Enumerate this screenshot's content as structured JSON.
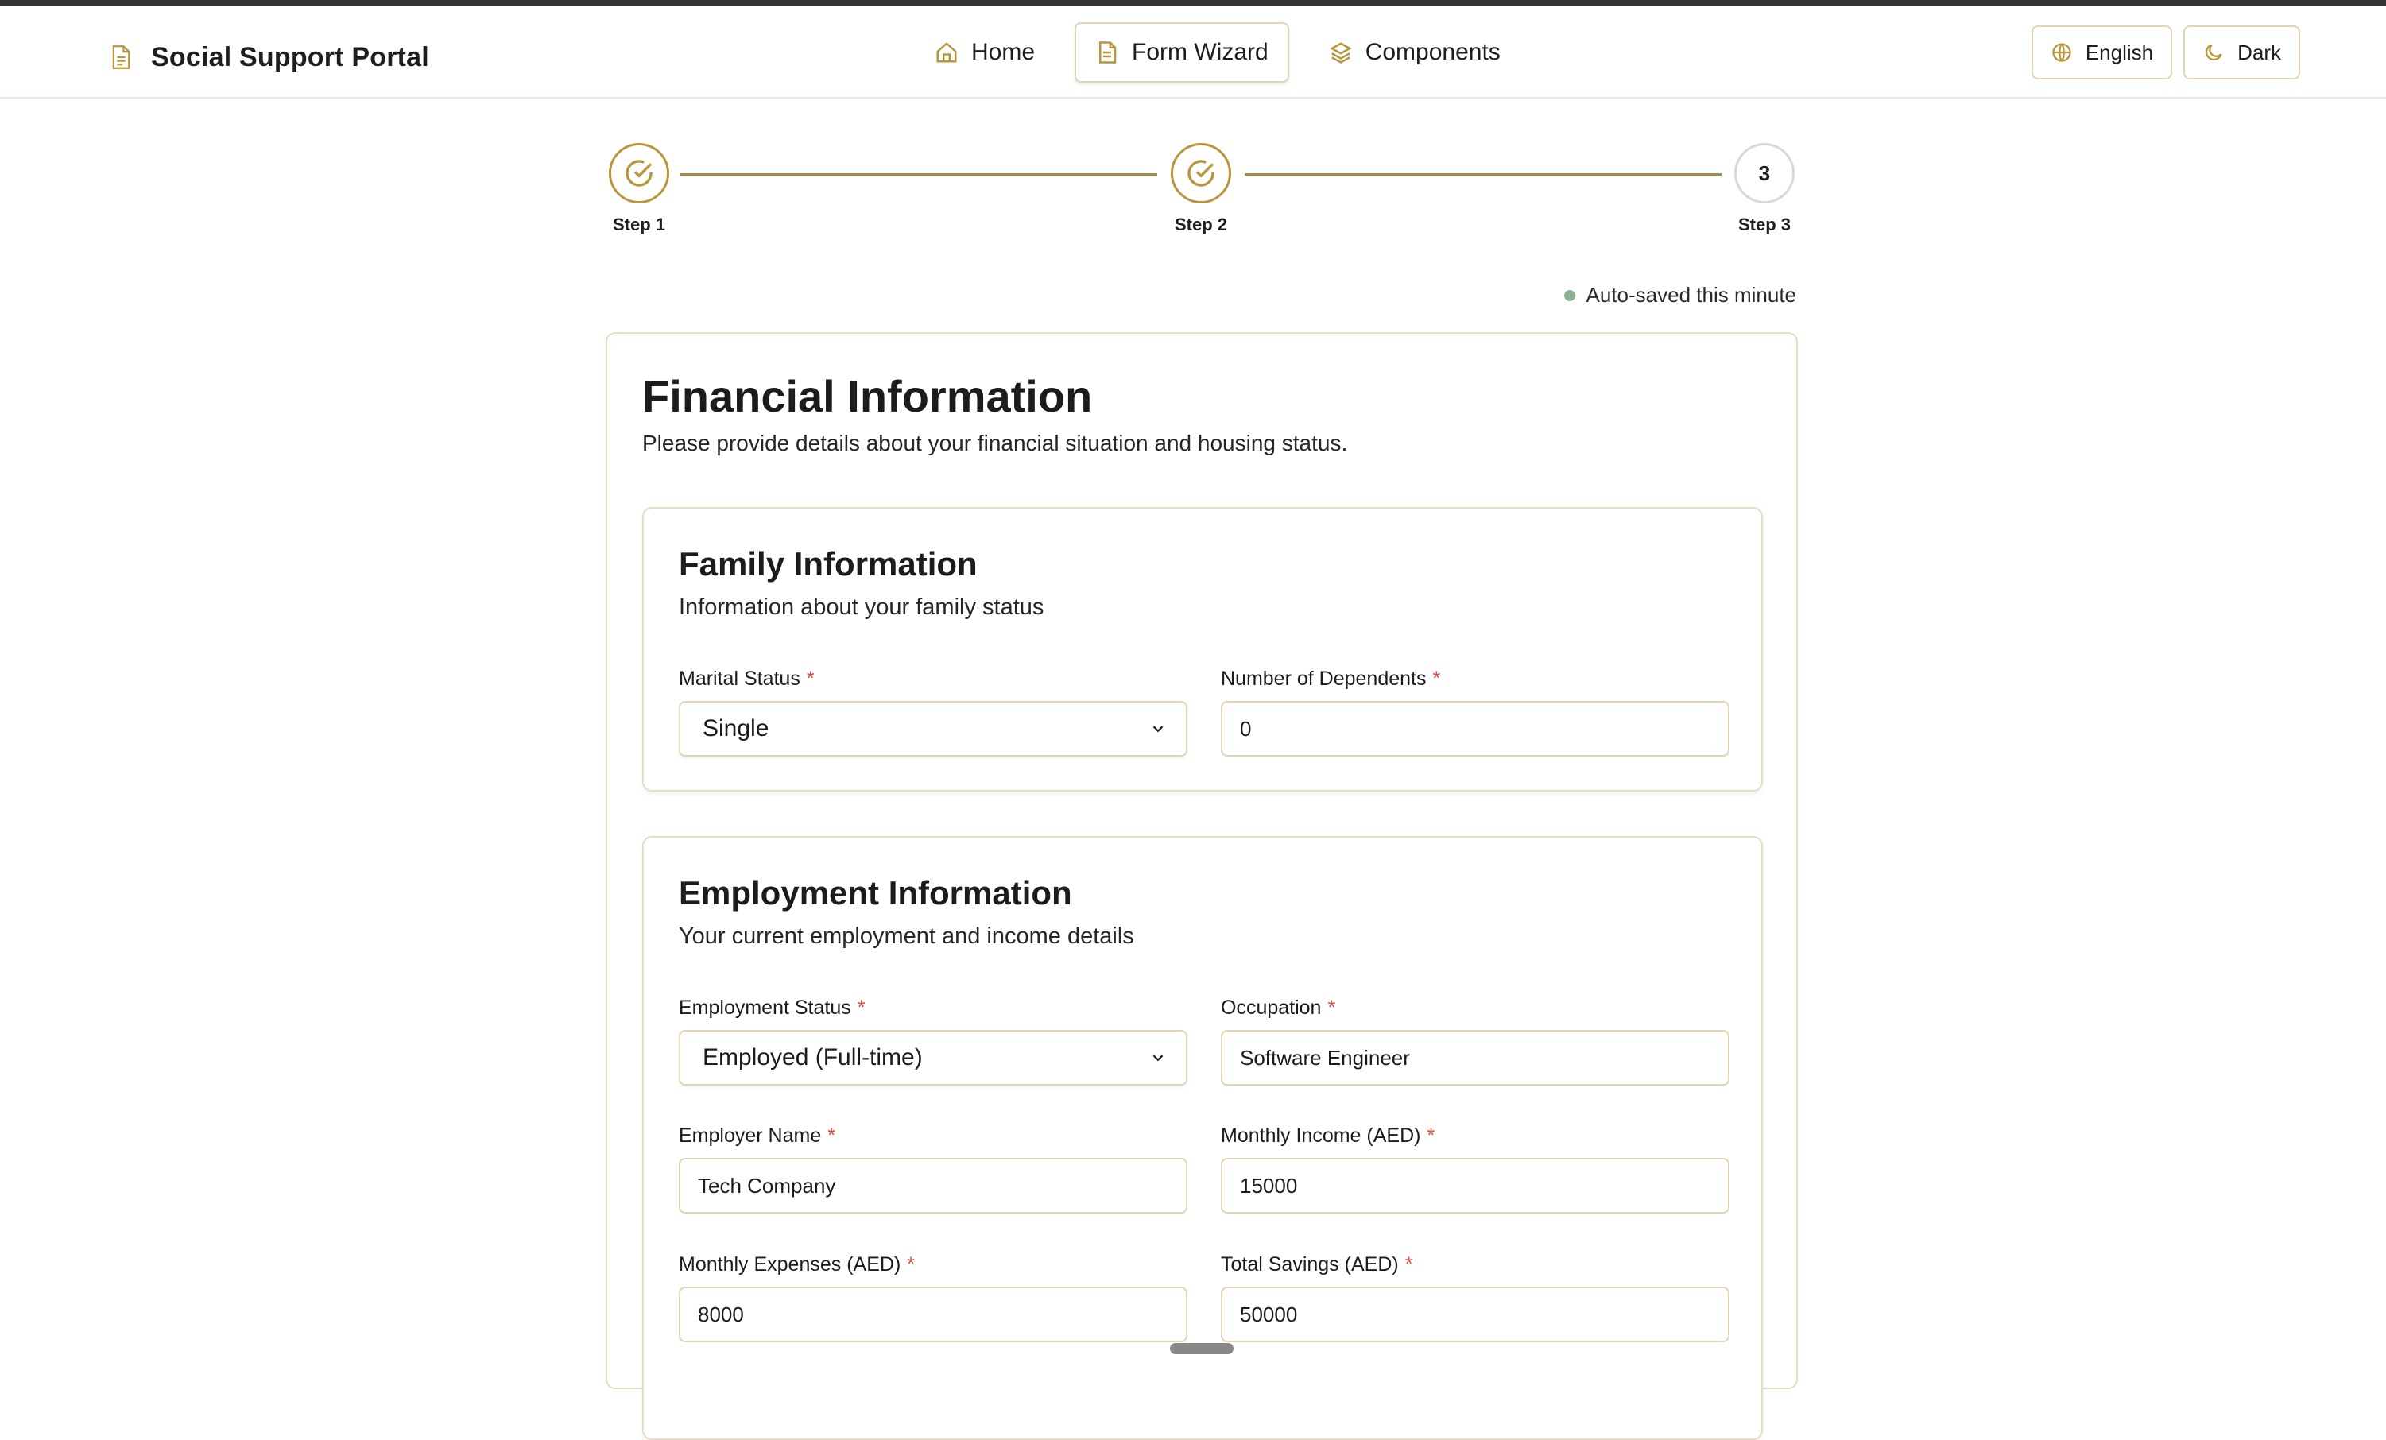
{
  "header": {
    "brand_title": "Social Support Portal",
    "nav": [
      {
        "label": "Home",
        "icon": "home-icon"
      },
      {
        "label": "Form Wizard",
        "icon": "document-icon",
        "active": true
      },
      {
        "label": "Components",
        "icon": "layers-icon"
      }
    ],
    "language_label": "English",
    "theme_label": "Dark"
  },
  "stepper": {
    "steps": [
      {
        "label": "Step 1",
        "state": "complete"
      },
      {
        "label": "Step 2",
        "state": "complete"
      },
      {
        "label": "Step 3",
        "number": "3",
        "state": "current"
      }
    ]
  },
  "autosave": {
    "text": "Auto-saved this minute"
  },
  "form": {
    "title": "Financial Information",
    "description": "Please provide details about your financial situation and housing status.",
    "family": {
      "title": "Family Information",
      "description": "Information about your family status",
      "marital_status": {
        "label": "Marital Status",
        "value": "Single"
      },
      "dependents": {
        "label": "Number of Dependents",
        "value": "0"
      }
    },
    "employment": {
      "title": "Employment Information",
      "description": "Your current employment and income details",
      "employment_status": {
        "label": "Employment Status",
        "value": "Employed (Full-time)"
      },
      "occupation": {
        "label": "Occupation",
        "value": "Software Engineer"
      },
      "employer_name": {
        "label": "Employer Name",
        "value": "Tech Company"
      },
      "monthly_income": {
        "label": "Monthly Income (AED)",
        "value": "15000"
      },
      "monthly_expenses": {
        "label": "Monthly Expenses (AED)",
        "value": "8000"
      },
      "total_savings": {
        "label": "Total Savings (AED)",
        "value": "50000"
      }
    },
    "required_marker": "*"
  },
  "colors": {
    "accent": "#b8963b",
    "border": "#e3d5b3",
    "required": "#e0453a",
    "saved_dot": "#8ab394"
  }
}
